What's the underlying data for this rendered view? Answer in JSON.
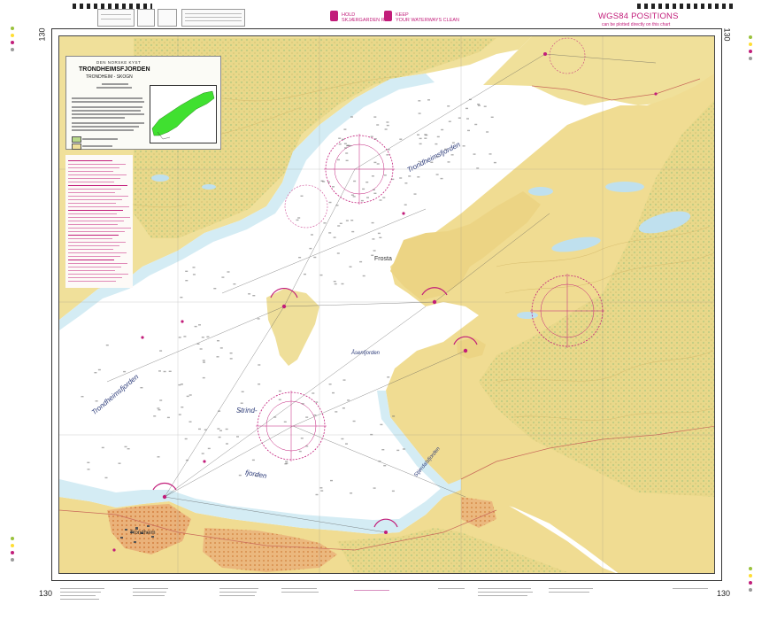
{
  "chart": {
    "number": "130",
    "publisher_line": "DEN NORSKE KYST",
    "title": "TRONDHEIMSFJORDEN",
    "subtitle": "TRONDHEIM - SKOGN"
  },
  "header": {
    "campaign_line1": "HOLD",
    "campaign_line2": "SKJÆRGARDEN REN",
    "campaign_line3": "KEEP",
    "campaign_line4": "YOUR WATERWAYS CLEAN",
    "wgs_title": "WGS84 POSITIONS",
    "wgs_subtitle": "can be plotted directly on this chart"
  },
  "map": {
    "labels": {
      "trondheimsfjorden_upper": "Trondheimsfjorden",
      "trondheimsfjorden_west": "Trondheimsfjorden",
      "frosta": "Frosta",
      "asenfjorden": "Åsenfjorden",
      "strind": "Strind-",
      "fjorden": "fjorden",
      "stjordalsfjorden": "Stjørdalsfjorden",
      "trondheim": "Trondheim"
    }
  },
  "colors": {
    "sea": "#ffffff",
    "shallow": "#d4ecf4",
    "land": "#f2e7a6",
    "land_dark": "#e8d27e",
    "forest": "#b9cf8e",
    "urban": "#e9a970",
    "magenta": "#c21d7a",
    "lake": "#bfe0ee"
  }
}
